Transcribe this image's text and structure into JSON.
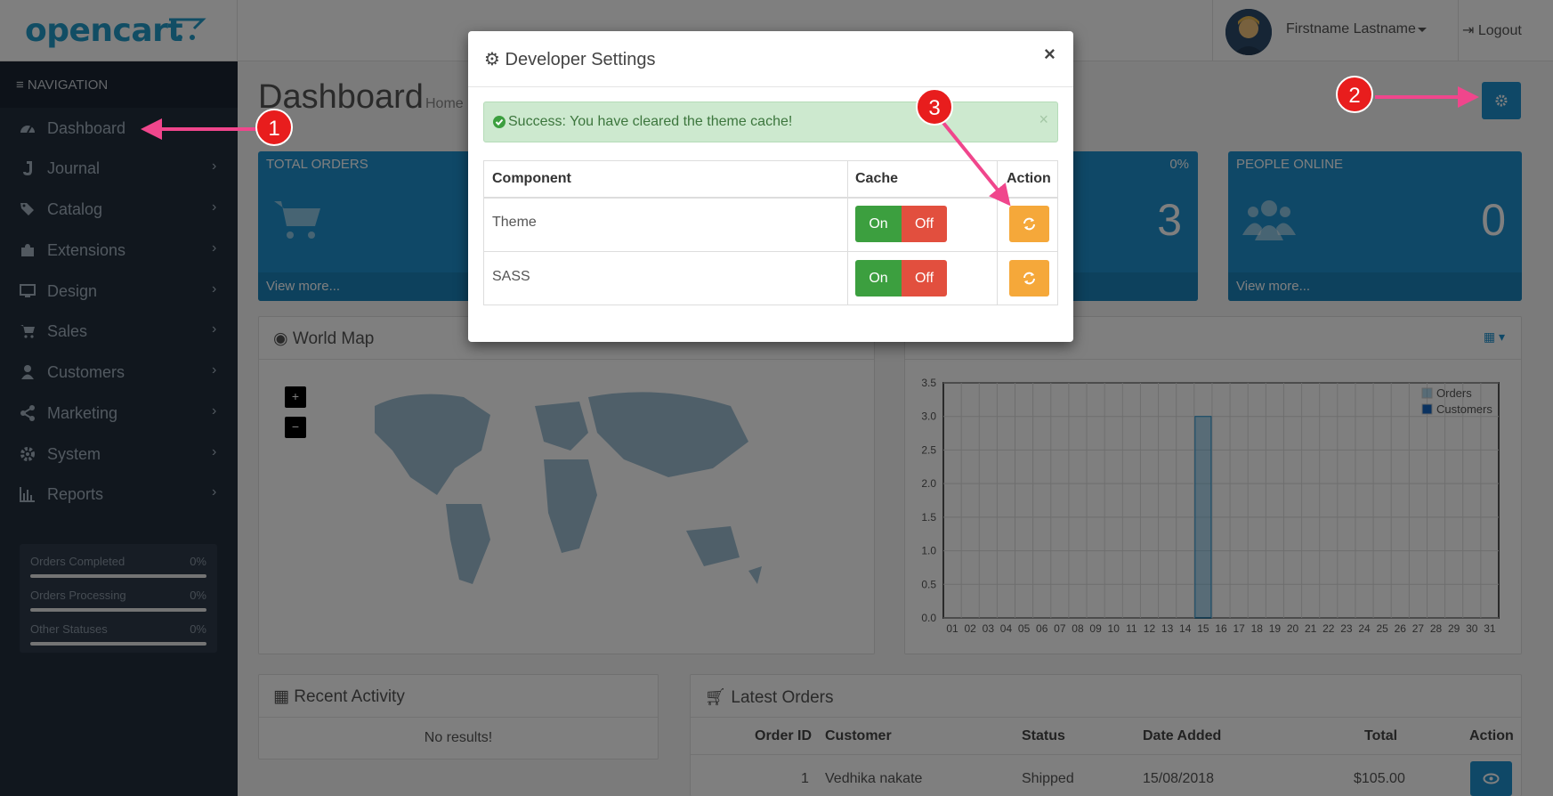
{
  "header": {
    "logo": "opencart",
    "user_name": "Firstname Lastname",
    "logout": "Logout"
  },
  "sidebar": {
    "title": "NAVIGATION",
    "items": [
      {
        "label": "Dashboard",
        "icon": "dashboard-icon"
      },
      {
        "label": "Journal",
        "icon": "journal-icon"
      },
      {
        "label": "Catalog",
        "icon": "tags-icon"
      },
      {
        "label": "Extensions",
        "icon": "puzzle-icon"
      },
      {
        "label": "Design",
        "icon": "monitor-icon"
      },
      {
        "label": "Sales",
        "icon": "cart-icon"
      },
      {
        "label": "Customers",
        "icon": "user-icon"
      },
      {
        "label": "Marketing",
        "icon": "share-icon"
      },
      {
        "label": "System",
        "icon": "gear-icon"
      },
      {
        "label": "Reports",
        "icon": "bar-chart-icon"
      }
    ],
    "stats": [
      {
        "label": "Orders Completed",
        "pct": "0%",
        "progress": 0
      },
      {
        "label": "Orders Processing",
        "pct": "0%",
        "progress": 0
      },
      {
        "label": "Other Statuses",
        "pct": "0%",
        "progress": 0
      }
    ]
  },
  "main": {
    "page_title": "Dashboard",
    "breadcrumb": "Home",
    "tiles": [
      {
        "title": "TOTAL ORDERS",
        "pct": "",
        "value": "",
        "footer": "View more..."
      },
      {
        "title": "",
        "pct": "0%",
        "value": "3",
        "footer": ""
      },
      {
        "title": "PEOPLE ONLINE",
        "pct": "",
        "value": "0",
        "footer": "View more..."
      }
    ],
    "world_map": {
      "title": "World Map",
      "zoom_in": "+",
      "zoom_out": "−"
    },
    "recent_activity": {
      "title": "Recent Activity",
      "empty": "No results!"
    },
    "latest_orders": {
      "title": "Latest Orders",
      "columns": [
        "Order ID",
        "Customer",
        "Status",
        "Date Added",
        "Total",
        "Action"
      ],
      "rows": [
        {
          "order_id": "1",
          "customer": "Vedhika nakate",
          "status": "Shipped",
          "date": "15/08/2018",
          "total": "$105.00"
        }
      ]
    }
  },
  "chart_data": {
    "type": "bar",
    "categories": [
      "01",
      "02",
      "03",
      "04",
      "05",
      "06",
      "07",
      "08",
      "09",
      "10",
      "11",
      "12",
      "13",
      "14",
      "15",
      "16",
      "17",
      "18",
      "19",
      "20",
      "21",
      "22",
      "23",
      "24",
      "25",
      "26",
      "27",
      "28",
      "29",
      "30",
      "31"
    ],
    "series": [
      {
        "name": "Orders",
        "values": [
          0,
          0,
          0,
          0,
          0,
          0,
          0,
          0,
          0,
          0,
          0,
          0,
          0,
          0,
          3,
          0,
          0,
          0,
          0,
          0,
          0,
          0,
          0,
          0,
          0,
          0,
          0,
          0,
          0,
          0,
          0
        ]
      },
      {
        "name": "Customers",
        "values": [
          0,
          0,
          0,
          0,
          0,
          0,
          0,
          0,
          0,
          0,
          0,
          0,
          0,
          0,
          0,
          0,
          0,
          0,
          0,
          0,
          0,
          0,
          0,
          0,
          0,
          0,
          0,
          0,
          0,
          0,
          0
        ]
      }
    ],
    "yticks": [
      "0.0",
      "0.5",
      "1.0",
      "1.5",
      "2.0",
      "2.5",
      "3.0",
      "3.5"
    ],
    "ylim": [
      0,
      3.5
    ],
    "legend": "top-right",
    "grid": true
  },
  "modal": {
    "title": "Developer Settings",
    "close": "×",
    "alert": "Success: You have cleared the theme cache!",
    "alert_close": "×",
    "columns": [
      "Component",
      "Cache",
      "Action"
    ],
    "rows": [
      {
        "component": "Theme",
        "on": "On",
        "off": "Off"
      },
      {
        "component": "SASS",
        "on": "On",
        "off": "Off"
      }
    ]
  },
  "annotations": [
    "1",
    "2",
    "3"
  ],
  "colors": {
    "primary": "#1e91cf",
    "sidebar": "#222f3d",
    "success_bg": "#cde9cf",
    "on": "#3c9f3f",
    "off": "#e24f3e",
    "warning": "#f5a83a",
    "annotation": "#e81d1d",
    "arrow": "#f0468c"
  }
}
